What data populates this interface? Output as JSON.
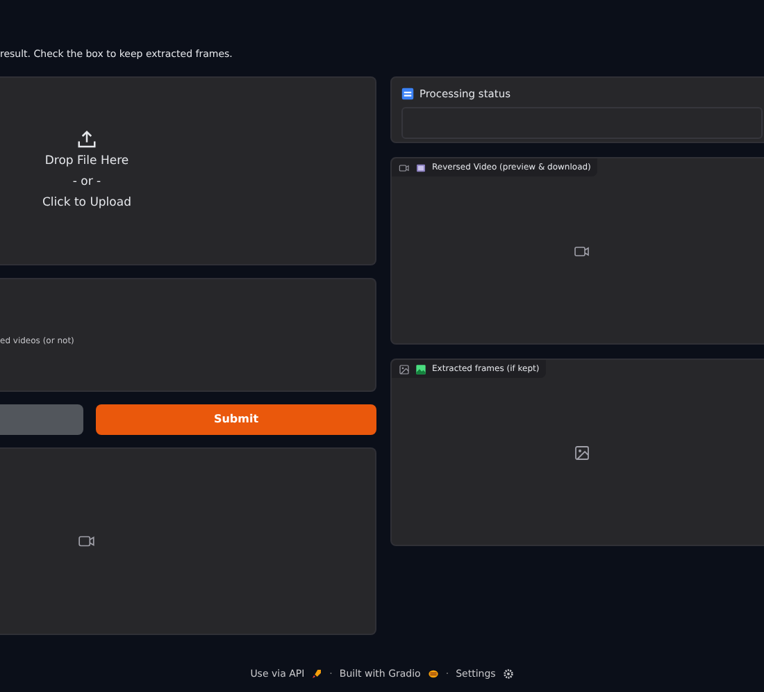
{
  "description": "result. Check the box to keep extracted frames.",
  "upload": {
    "primary": "Drop File Here",
    "separator": "- or -",
    "secondary": "Click to Upload"
  },
  "checkbox_info": "ed videos (or not)",
  "buttons": [
    {
      "kind": "secondary"
    },
    {
      "kind": "primary",
      "label": "Submit"
    }
  ],
  "status": {
    "label": "Processing status"
  },
  "outputs": [
    {
      "kind": "video",
      "label": "Reversed Video (preview & download)"
    },
    {
      "kind": "gallery",
      "label": "Extracted frames (if kept)"
    }
  ],
  "footer": [
    {
      "kind": "api",
      "label": "Use via API"
    },
    {
      "kind": "gradio",
      "separator": "·",
      "label": "Built with Gradio"
    },
    {
      "kind": "settings",
      "separator": "·",
      "label": "Settings"
    }
  ]
}
